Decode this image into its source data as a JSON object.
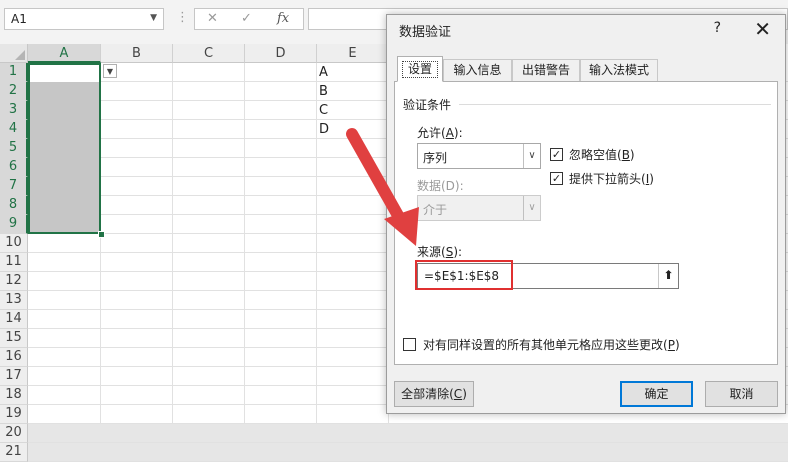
{
  "formula_bar": {
    "name_box": "A1",
    "cancel_glyph": "✕",
    "enter_glyph": "✓",
    "fx_label": "fx",
    "formula": ""
  },
  "sheet": {
    "columns": [
      "A",
      "B",
      "C",
      "D",
      "E"
    ],
    "rows": [
      "1",
      "2",
      "3",
      "4",
      "5",
      "6",
      "7",
      "8",
      "9",
      "10",
      "11",
      "12",
      "13",
      "14",
      "15",
      "16",
      "17",
      "18",
      "19",
      "20",
      "21"
    ],
    "selected_column": "A",
    "selected_range": "A1:A9",
    "e_values": [
      "A",
      "B",
      "C",
      "D"
    ],
    "accent_color": "#217346"
  },
  "dialog": {
    "title": "数据验证",
    "help": "?",
    "close": "✕",
    "tabs": [
      "设置",
      "输入信息",
      "出错警告",
      "输入法模式"
    ],
    "active_tab": "设置",
    "section_title": "验证条件",
    "allow_label_pre": "允许(",
    "allow_label_key": "A",
    "allow_label_post": "):",
    "allow_value": "序列",
    "ignore_blank_pre": "忽略空值(",
    "ignore_blank_key": "B",
    "ignore_blank_post": ")",
    "ignore_blank_checked": true,
    "dropdown_pre": "提供下拉箭头(",
    "dropdown_key": "I",
    "dropdown_post": ")",
    "dropdown_checked": true,
    "data_label": "数据(D):",
    "data_value": "介于",
    "source_label_pre": "来源(",
    "source_label_key": "S",
    "source_label_post": "):",
    "source_value": "=$E$1:$E$8",
    "apply_all_pre": "对有同样设置的所有其他单元格应用这些更改(",
    "apply_all_key": "P",
    "apply_all_post": ")",
    "apply_all_checked": false,
    "clear_all_pre": "全部清除(",
    "clear_all_key": "C",
    "clear_all_post": ")",
    "ok_label": "确定",
    "cancel_label": "取消",
    "highlight_color": "#e03030",
    "arrow_color": "#e04040"
  }
}
